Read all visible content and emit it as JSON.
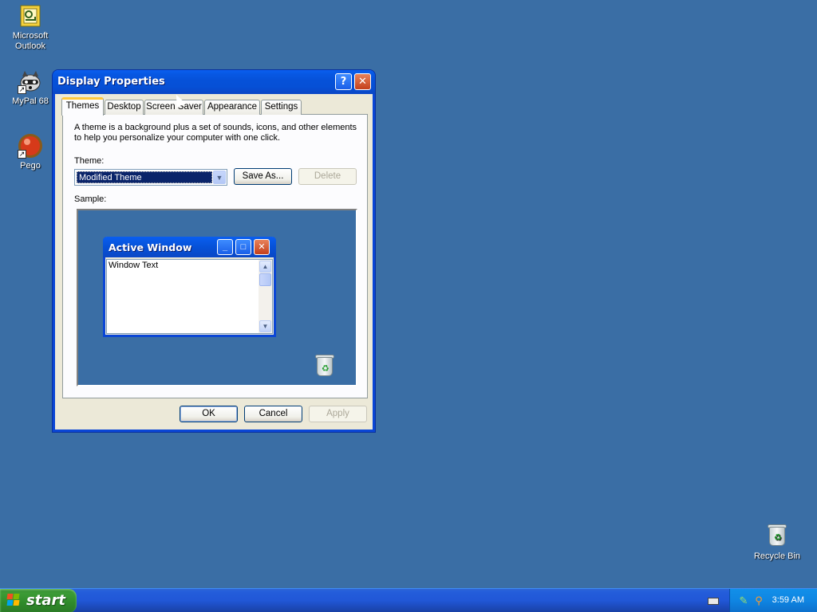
{
  "desktop": {
    "icons": [
      {
        "label_line1": "Microsoft",
        "label_line2": "Outlook",
        "icon": "outlook-icon"
      },
      {
        "label_line1": "MyPal 68",
        "label_line2": "",
        "icon": "mypal-raccoon-icon"
      },
      {
        "label_line1": "Pego",
        "label_line2": "",
        "icon": "pego-red-ball-icon"
      },
      {
        "label_line1": "Recycle Bin",
        "label_line2": "",
        "icon": "recycle-bin-icon"
      }
    ]
  },
  "dialog": {
    "title": "Display Properties",
    "help_glyph": "?",
    "close_glyph": "✕",
    "tabs": [
      "Themes",
      "Desktop",
      "Screen Saver",
      "Appearance",
      "Settings"
    ],
    "active_tab": "Themes",
    "description": "A theme is a background plus a set of sounds, icons, and other elements to help you personalize your computer with one click.",
    "theme_label": "Theme:",
    "theme_value": "Modified Theme",
    "save_as_label": "Save As...",
    "delete_label": "Delete",
    "sample_label": "Sample:",
    "sample": {
      "window_title": "Active Window",
      "window_text": "Window Text"
    },
    "ok_label": "OK",
    "cancel_label": "Cancel",
    "apply_label": "Apply"
  },
  "taskbar": {
    "start_label": "start",
    "clock": "3:59 AM"
  },
  "colors": {
    "desktop_bg": "#3a6ea5",
    "titlebar_blue": "#0651d8",
    "start_green": "#3c9b36",
    "selection": "#0a246a"
  }
}
